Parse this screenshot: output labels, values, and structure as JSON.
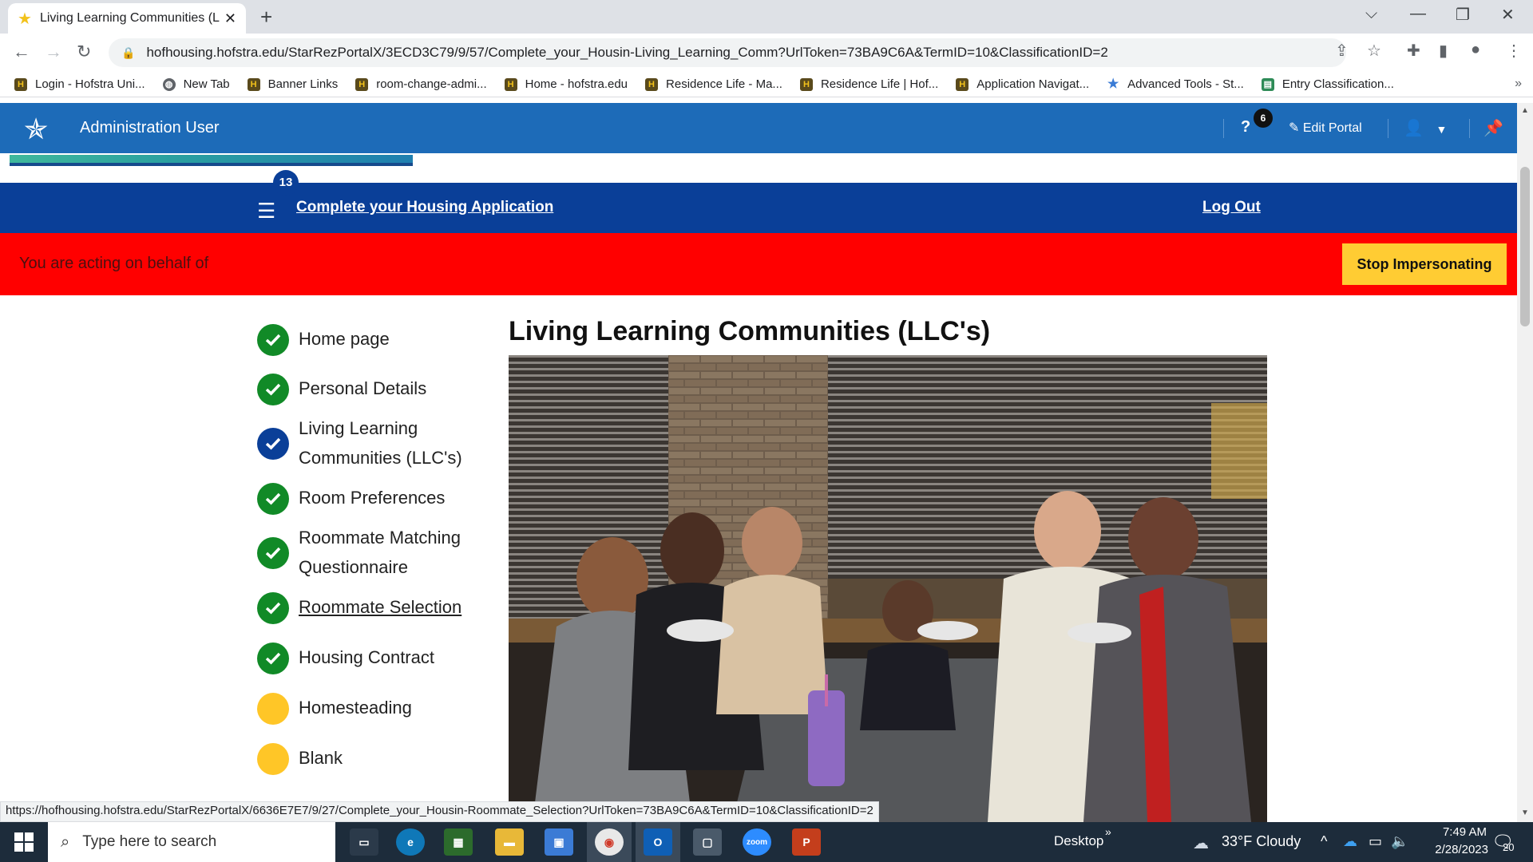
{
  "browser": {
    "tab_title": "Living Learning Communities (LLC",
    "url": "hofhousing.hofstra.edu/StarRezPortalX/3ECD3C79/9/57/Complete_your_Housin-Living_Learning_Comm?UrlToken=73BA9C6A&TermID=10&ClassificationID=2",
    "bookmarks": [
      {
        "label": "Login - Hofstra Uni...",
        "icon": "hofstra-shield"
      },
      {
        "label": "New Tab",
        "icon": "globe"
      },
      {
        "label": "Banner Links",
        "icon": "hofstra-shield"
      },
      {
        "label": "room-change-admi...",
        "icon": "hofstra-shield"
      },
      {
        "label": "Home - hofstra.edu",
        "icon": "hofstra-shield"
      },
      {
        "label": "Residence Life - Ma...",
        "icon": "hofstra-shield"
      },
      {
        "label": "Residence Life | Hof...",
        "icon": "hofstra-shield"
      },
      {
        "label": "Application Navigat...",
        "icon": "hofstra-shield"
      },
      {
        "label": "Advanced Tools - St...",
        "icon": "starrez-star"
      },
      {
        "label": "Entry Classification...",
        "icon": "green-doc"
      }
    ],
    "status_url": "https://hofhousing.hofstra.edu/StarRezPortalX/6636E7E7/9/27/Complete_your_Housin-Roommate_Selection?UrlToken=73BA9C6A&TermID=10&ClassificationID=2"
  },
  "portal": {
    "user": "Administration User",
    "help_count": "6",
    "edit_portal": "Edit Portal"
  },
  "sitenav": {
    "step_count": "13",
    "title": "Complete your Housing Application",
    "logout": "Log Out"
  },
  "impersonation": {
    "message": "You are acting on behalf of",
    "stop_label": "Stop Impersonating"
  },
  "steps": [
    {
      "label": "Home page",
      "status": "done"
    },
    {
      "label": "Personal Details",
      "status": "done"
    },
    {
      "label": "Living Learning Communities (LLC's)",
      "status": "current"
    },
    {
      "label": "Room Preferences",
      "status": "done"
    },
    {
      "label": "Roommate Matching Questionnaire",
      "status": "done"
    },
    {
      "label": "Roommate Selection",
      "status": "done"
    },
    {
      "label": "Housing Contract",
      "status": "done"
    },
    {
      "label": "Homesteading",
      "status": "pending"
    },
    {
      "label": "Blank",
      "status": "pending"
    }
  ],
  "content": {
    "title": "Living Learning Communities (LLC's)"
  },
  "taskbar": {
    "search_placeholder": "Type here to search",
    "desktop_label": "Desktop",
    "weather": "33°F  Cloudy",
    "time": "7:49 AM",
    "date": "2/28/2023",
    "notifications": "20"
  }
}
